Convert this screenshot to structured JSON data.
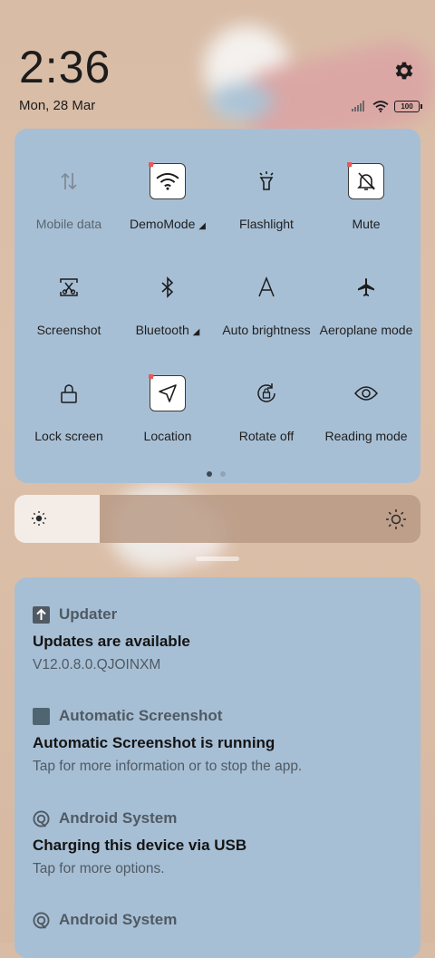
{
  "status": {
    "time": "2:36",
    "date": "Mon, 28 Mar",
    "battery": "100"
  },
  "quick_settings": {
    "tiles": [
      {
        "label": "Mobile data",
        "icon": "mobile-data-icon",
        "active": false
      },
      {
        "label": "DemoMode",
        "icon": "wifi-icon",
        "active": true,
        "expandable": true
      },
      {
        "label": "Flashlight",
        "icon": "flashlight-icon",
        "active": false
      },
      {
        "label": "Mute",
        "icon": "mute-bell-icon",
        "active": true
      },
      {
        "label": "Screenshot",
        "icon": "screenshot-icon",
        "active": false
      },
      {
        "label": "Bluetooth",
        "icon": "bluetooth-icon",
        "active": false,
        "expandable": true
      },
      {
        "label": "Auto brightness",
        "icon": "auto-brightness-icon",
        "active": false
      },
      {
        "label": "Aeroplane mode",
        "icon": "airplane-icon",
        "active": false
      },
      {
        "label": "Lock screen",
        "icon": "lock-icon",
        "active": false
      },
      {
        "label": "Location",
        "icon": "location-arrow-icon",
        "active": true
      },
      {
        "label": "Rotate off",
        "icon": "rotate-lock-icon",
        "active": false
      },
      {
        "label": "Reading mode",
        "icon": "eye-icon",
        "active": false
      }
    ],
    "page_index": 0,
    "page_count": 2
  },
  "brightness": {
    "level": 0.21
  },
  "notifications": [
    {
      "app": "Updater",
      "title": "Updates are available",
      "body": "V12.0.8.0.QJOINXM",
      "icon": "updater-icon"
    },
    {
      "app": "Automatic Screenshot",
      "title": "Automatic Screenshot is running",
      "body": "Tap for more information or to stop the app.",
      "icon": "screenshot-app-icon"
    },
    {
      "app": "Android System",
      "title": "Charging this device via USB",
      "body": "Tap for more options.",
      "icon": "android-system-icon"
    },
    {
      "app": "Android System",
      "title": "",
      "body": "",
      "icon": "android-system-icon"
    }
  ],
  "colors": {
    "panel": "#a7bfd5",
    "wallpaper": "#d8bca6",
    "text_primary": "#141414",
    "text_secondary": "#4f5a63"
  }
}
